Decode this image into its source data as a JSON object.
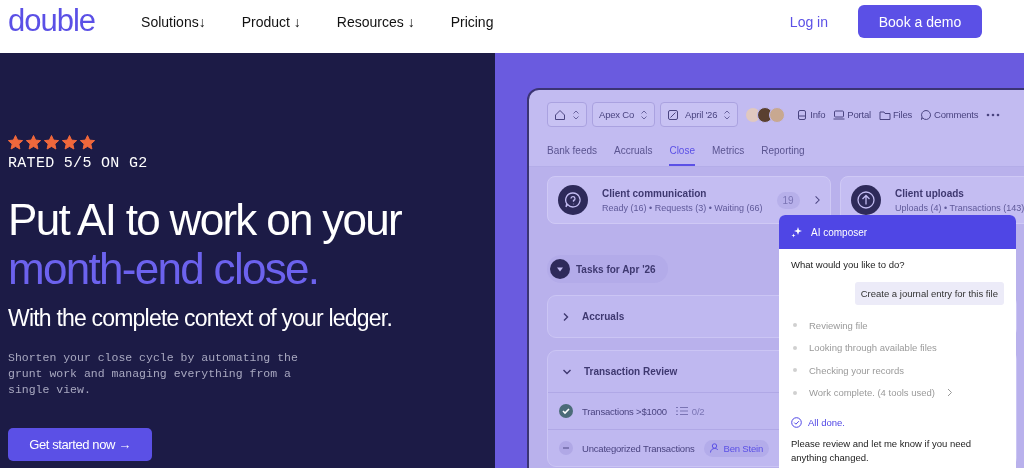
{
  "header": {
    "logo": "double",
    "nav": [
      {
        "label": "Solutions↓"
      },
      {
        "label": "Product ↓"
      },
      {
        "label": "Resources ↓"
      },
      {
        "label": "Pricing"
      }
    ],
    "login": "Log in",
    "cta": "Book a demo"
  },
  "hero": {
    "stars": 5,
    "rating": "RATED 5/5 ON G2",
    "headline": "Put AI to work on your",
    "headline_accent": "month-end close.",
    "subheadline": "With the complete context of your ledger.",
    "description": "Shorten your close cycle by automating the grunt work and managing everything from a single view.",
    "cta": "Get started now →"
  },
  "app": {
    "company": "Apex Co",
    "period": "April '26",
    "links": [
      "Info",
      "Portal",
      "Files",
      "Comments"
    ],
    "tabs": [
      {
        "label": "Bank feeds",
        "selected": false
      },
      {
        "label": "Accruals",
        "selected": false
      },
      {
        "label": "Close",
        "selected": true
      },
      {
        "label": "Metrics",
        "selected": false
      },
      {
        "label": "Reporting",
        "selected": false
      }
    ],
    "cards": [
      {
        "title": "Client communication",
        "subtitle": "Ready (16) • Requests (3) • Waiting (66)",
        "badge": "19"
      },
      {
        "title": "Client uploads",
        "subtitle": "Uploads (4) • Transactions (143)"
      }
    ],
    "tasks_label": "Tasks for Apr '26",
    "sections": [
      {
        "title": "Accruals",
        "expanded": false
      },
      {
        "title": "Transaction Review",
        "expanded": true,
        "rows": [
          {
            "label": "Transactions >$1000",
            "completed": true,
            "count": "0/2"
          },
          {
            "label": "Uncategorized Transactions",
            "completed": false,
            "assignee": "Ben Stein"
          }
        ]
      }
    ]
  },
  "composer": {
    "title": "AI composer",
    "question": "What would you like to do?",
    "user_message": "Create a journal entry for this file",
    "steps": [
      "Reviewing file",
      "Looking through available files",
      "Checking your records",
      "Work complete. (4 tools used)"
    ],
    "done": "All done.",
    "reply": "Please review and let me know if you need anything changed."
  }
}
